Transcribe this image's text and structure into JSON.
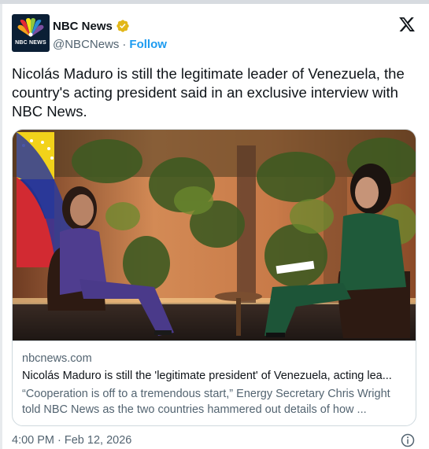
{
  "account": {
    "name": "NBC News",
    "handle": "@NBCNews",
    "separator": "·",
    "follow_label": "Follow",
    "avatar_text": "NBC NEWS"
  },
  "tweet": {
    "text": "Nicolás Maduro is still the legitimate leader of Venezuela, the country's acting president said in an exclusive interview with NBC News."
  },
  "card": {
    "domain": "nbcnews.com",
    "title": "Nicolás Maduro is still the 'legitimate president' of Venezuela, acting lea...",
    "description": "“Cooperation is off to a tremendous start,” Energy Secretary Chris Wright told NBC News as the two countries hammered out details of how ..."
  },
  "footer": {
    "timestamp": "4:00 PM · Feb 12, 2026"
  },
  "icons": {
    "verified": "verified-badge-icon",
    "platform": "x-logo-icon",
    "info": "info-icon"
  },
  "colors": {
    "link": "#1d9bf0",
    "verified_gold": "#e2b719",
    "text_secondary": "#536471",
    "border": "#cfd9de"
  }
}
